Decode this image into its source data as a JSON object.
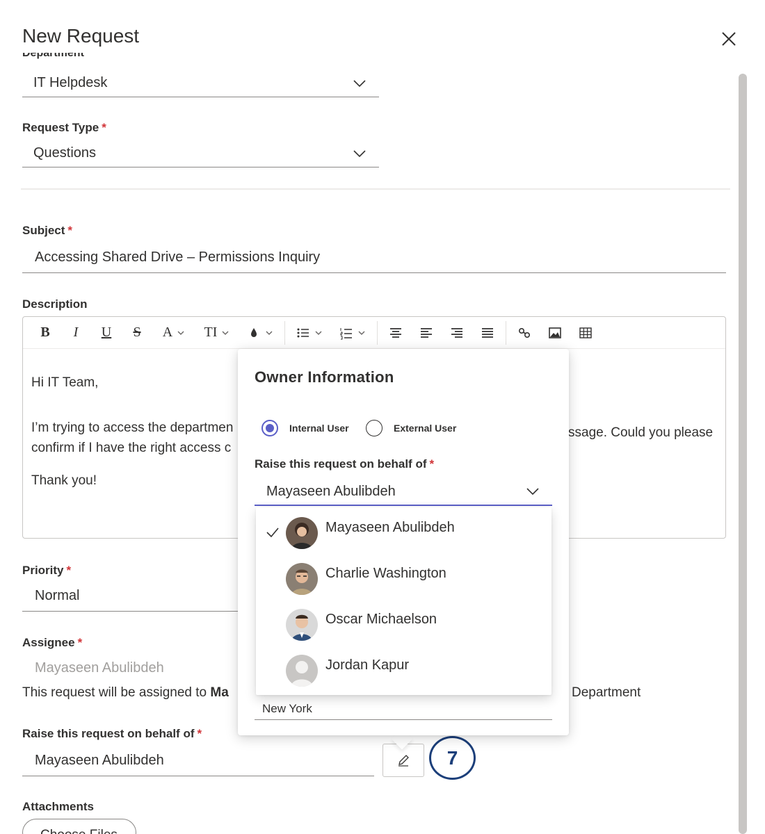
{
  "dialog": {
    "title": "New Request",
    "close_label": "×"
  },
  "form": {
    "department_label": "Department",
    "department_value": "IT Helpdesk",
    "request_type_label": "Request Type",
    "request_type_value": "Questions",
    "subject_label": "Subject",
    "subject_value": "Accessing Shared Drive – Permissions Inquiry",
    "description_label": "Description",
    "description_lines": [
      "Hi IT Team,",
      "I’m trying to access the departmen",
      "ssage. Could you please",
      "confirm if I have the right access c",
      "Thank you!"
    ],
    "priority_label": "Priority",
    "priority_value": "Normal",
    "assignee_label": "Assignee",
    "assignee_value": "Mayaseen Abulibdeh",
    "assign_note_prefix": "This request will be assigned to ",
    "assign_note_bold": "Ma",
    "assign_note_suffix": "Department",
    "behalf_label": "Raise this request on behalf of",
    "behalf_value": "Mayaseen Abulibdeh",
    "attachments_label": "Attachments",
    "choose_files_label": "Choose Files",
    "required_mark": "*"
  },
  "toolbar": {
    "bold": "B",
    "italic": "I",
    "underline": "U",
    "strike": "S",
    "font_color": "A",
    "font_size": "TI"
  },
  "popup": {
    "title": "Owner Information",
    "radio_internal": "Internal User",
    "radio_external": "External User",
    "selected_user_type": "Internal User",
    "behalf_label": "Raise this request on behalf of",
    "behalf_value": "Mayaseen Abulibdeh",
    "location_value": "New York",
    "options": [
      {
        "name": "Mayaseen Abulibdeh",
        "selected": true
      },
      {
        "name": "Charlie Washington",
        "selected": false
      },
      {
        "name": "Oscar Michaelson",
        "selected": false
      },
      {
        "name": "Jordan Kapur",
        "selected": false
      }
    ]
  },
  "step_badge": "7",
  "colors": {
    "accent": "#5b5fc7",
    "required": "#d13438",
    "badge": "#1c3f7a"
  },
  "icons": [
    "close-icon",
    "chevron-down-icon",
    "check-icon",
    "pencil-icon",
    "link-icon",
    "image-icon",
    "table-icon"
  ]
}
